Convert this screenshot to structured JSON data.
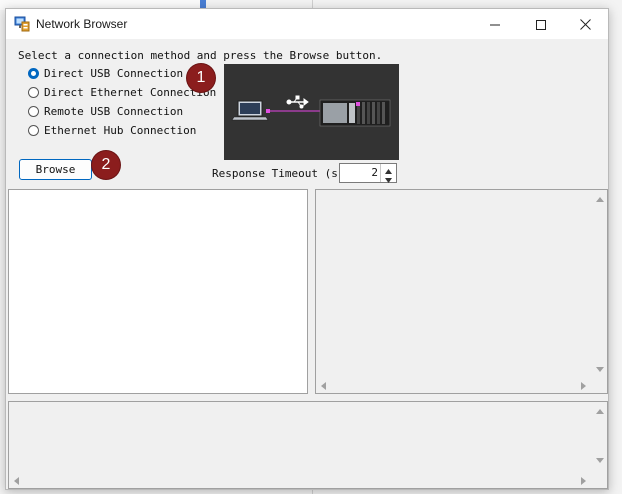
{
  "window": {
    "title": "Network Browser",
    "app_icon": "network-browser-app-icon",
    "controls": [
      "minimize-icon",
      "maximize-icon",
      "close-icon"
    ]
  },
  "instruction": "Select a connection method and press the Browse button.",
  "connection_methods": [
    {
      "label": "Direct USB Connection",
      "checked": true
    },
    {
      "label": "Direct Ethernet Connection",
      "checked": false
    },
    {
      "label": "Remote USB Connection",
      "checked": false
    },
    {
      "label": "Ethernet Hub Connection",
      "checked": false
    }
  ],
  "callouts": [
    "1",
    "2"
  ],
  "preview": {
    "icons": [
      "laptop-icon",
      "usb-icon",
      "plc-rack-icon"
    ],
    "link_color": "#c040c0"
  },
  "browse_label": "Browse",
  "response_timeout": {
    "label": "Response Timeout (s)",
    "value": "2"
  },
  "colors": {
    "accent": "#0067c0",
    "callout": "#8b1d1d",
    "preview_bg": "#333333"
  }
}
